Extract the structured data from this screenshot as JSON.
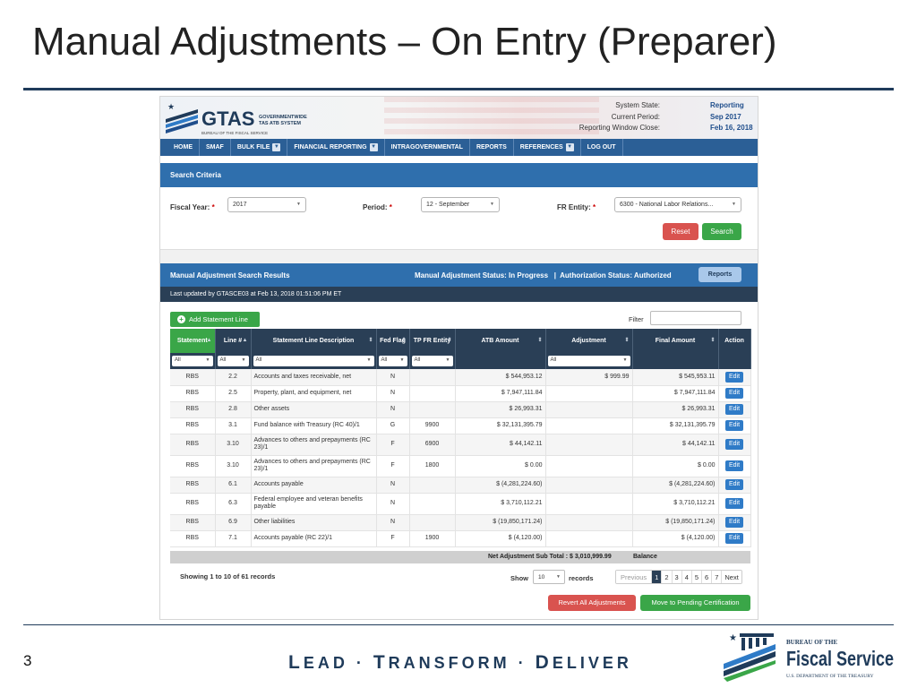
{
  "slide": {
    "title": "Manual Adjustments – On Entry (Preparer)",
    "page_number": "3",
    "tagline": {
      "l1": "L",
      "l2": "EAD",
      "sep1": " · ",
      "t1": "T",
      "t2": "RANSFORM",
      "sep2": " · ",
      "d1": "D",
      "d2": "ELIVER"
    },
    "logo": {
      "line1": "BUREAU OF THE",
      "line2": "Fiscal Service",
      "line3": "U.S. DEPARTMENT OF THE TREASURY"
    }
  },
  "app": {
    "logo": {
      "name": "GTAS",
      "sub1": "GOVERNMENTWIDE",
      "sub2": "TAS ATB SYSTEM",
      "sub3": "BUREAU OF THE FISCAL SERVICE"
    },
    "system": {
      "state_label": "System State:",
      "state_value": "Reporting",
      "period_label": "Current Period:",
      "period_value": "Sep 2017",
      "window_label": "Reporting Window Close:",
      "window_value": "Feb 16, 2018"
    },
    "nav": [
      {
        "label": "HOME",
        "dropdown": false
      },
      {
        "label": "SMAF",
        "dropdown": false
      },
      {
        "label": "BULK FILE",
        "dropdown": true
      },
      {
        "label": "FINANCIAL REPORTING",
        "dropdown": true
      },
      {
        "label": "INTRAGOVERNMENTAL",
        "dropdown": false
      },
      {
        "label": "REPORTS",
        "dropdown": false
      },
      {
        "label": "REFERENCES",
        "dropdown": true
      },
      {
        "label": "LOG OUT",
        "dropdown": false
      }
    ],
    "search": {
      "header": "Search Criteria",
      "fiscal_year_label": "Fiscal Year:",
      "fiscal_year_value": "2017",
      "period_label": "Period:",
      "period_value": "12 - September",
      "fr_entity_label": "FR Entity:",
      "fr_entity_value": "6300 - National Labor Relations...",
      "required_mark": "*",
      "reset_label": "Reset",
      "search_label": "Search"
    },
    "results": {
      "header": "Manual Adjustment Search Results",
      "status_text": "Manual Adjustment Status: In Progress   |  Authorization Status: Authorized",
      "reports_label": "Reports",
      "last_updated": "Last updated by GTASCE03 at Feb 13, 2018 01:51:06 PM ET",
      "add_label": "Add Statement Line",
      "filter_label": "Filter",
      "columns": [
        "Statement",
        "Line #",
        "Statement Line Description",
        "Fed Flag",
        "TP FR Entity",
        "ATB Amount",
        "Adjustment",
        "Final Amount",
        "Action"
      ],
      "filter_value": "All",
      "rows": [
        {
          "statement": "RBS",
          "line": "2.2",
          "desc": "Accounts and taxes receivable, net",
          "fed": "N",
          "tp": "",
          "atb": "$ 544,953.12",
          "adj": "$ 999.99",
          "final": "$ 545,953.11",
          "action": "Edit"
        },
        {
          "statement": "RBS",
          "line": "2.5",
          "desc": "Property, plant, and equipment, net",
          "fed": "N",
          "tp": "",
          "atb": "$ 7,947,111.84",
          "adj": "",
          "final": "$ 7,947,111.84",
          "action": "Edit"
        },
        {
          "statement": "RBS",
          "line": "2.8",
          "desc": "Other assets",
          "fed": "N",
          "tp": "",
          "atb": "$ 26,993.31",
          "adj": "",
          "final": "$ 26,993.31",
          "action": "Edit"
        },
        {
          "statement": "RBS",
          "line": "3.1",
          "desc": "Fund balance with Treasury (RC 40)/1",
          "fed": "G",
          "tp": "9900",
          "atb": "$ 32,131,395.79",
          "adj": "",
          "final": "$ 32,131,395.79",
          "action": "Edit"
        },
        {
          "statement": "RBS",
          "line": "3.10",
          "desc": "Advances to others and prepayments (RC 23)/1",
          "fed": "F",
          "tp": "6900",
          "atb": "$ 44,142.11",
          "adj": "",
          "final": "$ 44,142.11",
          "action": "Edit"
        },
        {
          "statement": "RBS",
          "line": "3.10",
          "desc": "Advances to others and prepayments (RC 23)/1",
          "fed": "F",
          "tp": "1800",
          "atb": "$ 0.00",
          "adj": "",
          "final": "$ 0.00",
          "action": "Edit"
        },
        {
          "statement": "RBS",
          "line": "6.1",
          "desc": "Accounts payable",
          "fed": "N",
          "tp": "",
          "atb": "$ (4,281,224.60)",
          "adj": "",
          "final": "$ (4,281,224.60)",
          "action": "Edit"
        },
        {
          "statement": "RBS",
          "line": "6.3",
          "desc": "Federal employee and veteran benefits payable",
          "fed": "N",
          "tp": "",
          "atb": "$ 3,710,112.21",
          "adj": "",
          "final": "$ 3,710,112.21",
          "action": "Edit"
        },
        {
          "statement": "RBS",
          "line": "6.9",
          "desc": "Other liabilities",
          "fed": "N",
          "tp": "",
          "atb": "$ (19,850,171.24)",
          "adj": "",
          "final": "$ (19,850,171.24)",
          "action": "Edit"
        },
        {
          "statement": "RBS",
          "line": "7.1",
          "desc": "Accounts payable (RC 22)/1",
          "fed": "F",
          "tp": "1900",
          "atb": "$ (4,120.00)",
          "adj": "",
          "final": "$ (4,120.00)",
          "action": "Edit"
        }
      ],
      "subtotal_label": "Net Adjustment Sub Total :  $ 3,010,999.99",
      "balance_label": "Balance",
      "showing": "Showing 1 to 10 of 61 records",
      "show_label": "Show",
      "page_size": "10",
      "records_label": "records",
      "pager": [
        "Previous",
        "1",
        "2",
        "3",
        "4",
        "5",
        "6",
        "7",
        "Next"
      ],
      "revert_label": "Revert All Adjustments",
      "move_label": "Move to Pending Certification"
    }
  }
}
